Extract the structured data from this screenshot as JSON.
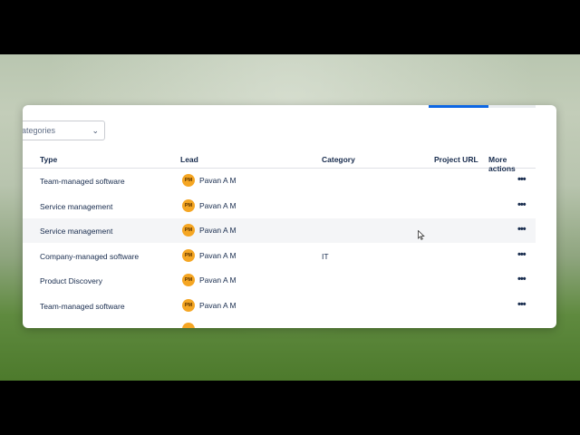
{
  "filter": {
    "label": "ategories",
    "chevron_icon": "chevron-down-icon"
  },
  "table": {
    "columns": [
      "Type",
      "Lead",
      "Category",
      "Project URL",
      "More actions"
    ],
    "rows": [
      {
        "type": "Team-managed software",
        "lead_initials": "PM",
        "lead": "Pavan A M",
        "category": "",
        "more": "•••"
      },
      {
        "type": "Service management",
        "lead_initials": "PM",
        "lead": "Pavan A M",
        "category": "",
        "more": "•••"
      },
      {
        "type": "Service management",
        "lead_initials": "PM",
        "lead": "Pavan A M",
        "category": "",
        "more": "•••"
      },
      {
        "type": "Company-managed software",
        "lead_initials": "PM",
        "lead": "Pavan A M",
        "category": "IT",
        "more": "•••"
      },
      {
        "type": "Product Discovery",
        "lead_initials": "PM",
        "lead": "Pavan A M",
        "category": "",
        "more": "•••"
      },
      {
        "type": "Team-managed software",
        "lead_initials": "PM",
        "lead": "Pavan A M",
        "category": "",
        "more": "•••"
      }
    ]
  },
  "colors": {
    "accent": "#0c66e4",
    "avatar": "#f5a623",
    "text": "#172b4d",
    "hover_row": "#f4f5f7"
  }
}
